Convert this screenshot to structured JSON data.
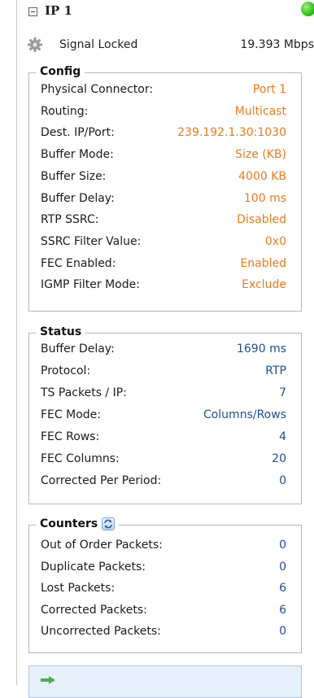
{
  "header": {
    "title": "IP 1",
    "status_color": "#33c21f"
  },
  "signal": {
    "status": "Signal Locked",
    "rate": "19.393 Mbps",
    "icon": "gear-icon"
  },
  "config": {
    "title": "Config",
    "rows": [
      {
        "label": "Physical Connector:",
        "value": "Port 1"
      },
      {
        "label": "Routing:",
        "value": "Multicast"
      },
      {
        "label": "Dest. IP/Port:",
        "value": "239.192.1.30:1030"
      },
      {
        "label": "Buffer Mode:",
        "value": "Size (KB)"
      },
      {
        "label": "Buffer Size:",
        "value": "4000 KB"
      },
      {
        "label": "Buffer Delay:",
        "value": "100 ms"
      },
      {
        "label": "RTP SSRC:",
        "value": "Disabled"
      },
      {
        "label": "SSRC Filter Value:",
        "value": "0x0"
      },
      {
        "label": "FEC Enabled:",
        "value": "Enabled"
      },
      {
        "label": "IGMP Filter Mode:",
        "value": "Exclude"
      }
    ]
  },
  "status": {
    "title": "Status",
    "rows": [
      {
        "label": "Buffer Delay:",
        "value": "1690 ms"
      },
      {
        "label": "Protocol:",
        "value": "RTP"
      },
      {
        "label": "TS Packets / IP:",
        "value": "7"
      },
      {
        "label": "FEC Mode:",
        "value": "Columns/Rows"
      },
      {
        "label": "FEC Rows:",
        "value": "4"
      },
      {
        "label": "FEC Columns:",
        "value": "20"
      },
      {
        "label": "Corrected Per Period:",
        "value": "0"
      }
    ]
  },
  "counters": {
    "title": "Counters",
    "refresh_icon": "refresh-icon",
    "rows": [
      {
        "label": "Out of Order Packets:",
        "value": "0"
      },
      {
        "label": "Duplicate Packets:",
        "value": "0"
      },
      {
        "label": "Lost Packets:",
        "value": "6"
      },
      {
        "label": "Corrected Packets:",
        "value": "6"
      },
      {
        "label": "Uncorrected Packets:",
        "value": "0"
      }
    ]
  },
  "colors": {
    "config_value": "#ea7b1c",
    "status_value": "#1d4e95"
  }
}
